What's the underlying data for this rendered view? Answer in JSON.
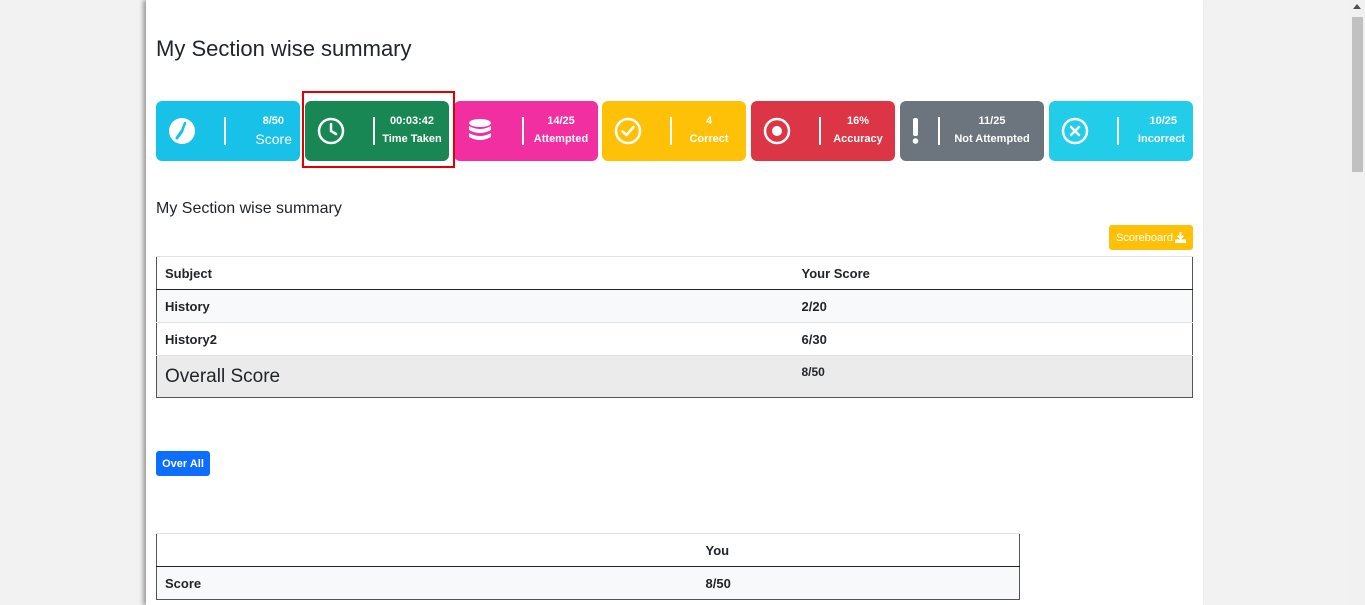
{
  "page": {
    "title": "My Section wise summary"
  },
  "cards": [
    {
      "value": "8/50",
      "label": "Score",
      "icon": "gauge-icon",
      "color": "#17c1e8"
    },
    {
      "value": "00:03:42",
      "label": "Time Taken",
      "icon": "clock-icon",
      "color": "#198754"
    },
    {
      "value": "14/25",
      "label": "Attempted",
      "icon": "database-icon",
      "color": "#f22fa0"
    },
    {
      "value": "4",
      "label": "Correct",
      "icon": "check-circle-icon",
      "color": "#ffc107"
    },
    {
      "value": "16%",
      "label": "Accuracy",
      "icon": "target-icon",
      "color": "#dc3545"
    },
    {
      "value": "11/25",
      "label": "Not Attempted",
      "icon": "exclamation-icon",
      "color": "#6c757d"
    },
    {
      "value": "10/25",
      "label": "Incorrect",
      "icon": "x-circle-icon",
      "color": "#22cdea"
    }
  ],
  "section": {
    "title": "My Section wise summary",
    "scoreboard_label": "Scoreboard",
    "headers": [
      "Subject",
      "Your Score"
    ],
    "rows": [
      {
        "subject": "History",
        "score": "2/20"
      },
      {
        "subject": "History2",
        "score": "6/30"
      }
    ],
    "overall": {
      "label": "Overall Score",
      "score": "8/50"
    }
  },
  "overall_button": "Over All",
  "comparison": {
    "headers": [
      "",
      "You"
    ],
    "rows": [
      {
        "label": "Score",
        "value": "8/50"
      }
    ]
  }
}
